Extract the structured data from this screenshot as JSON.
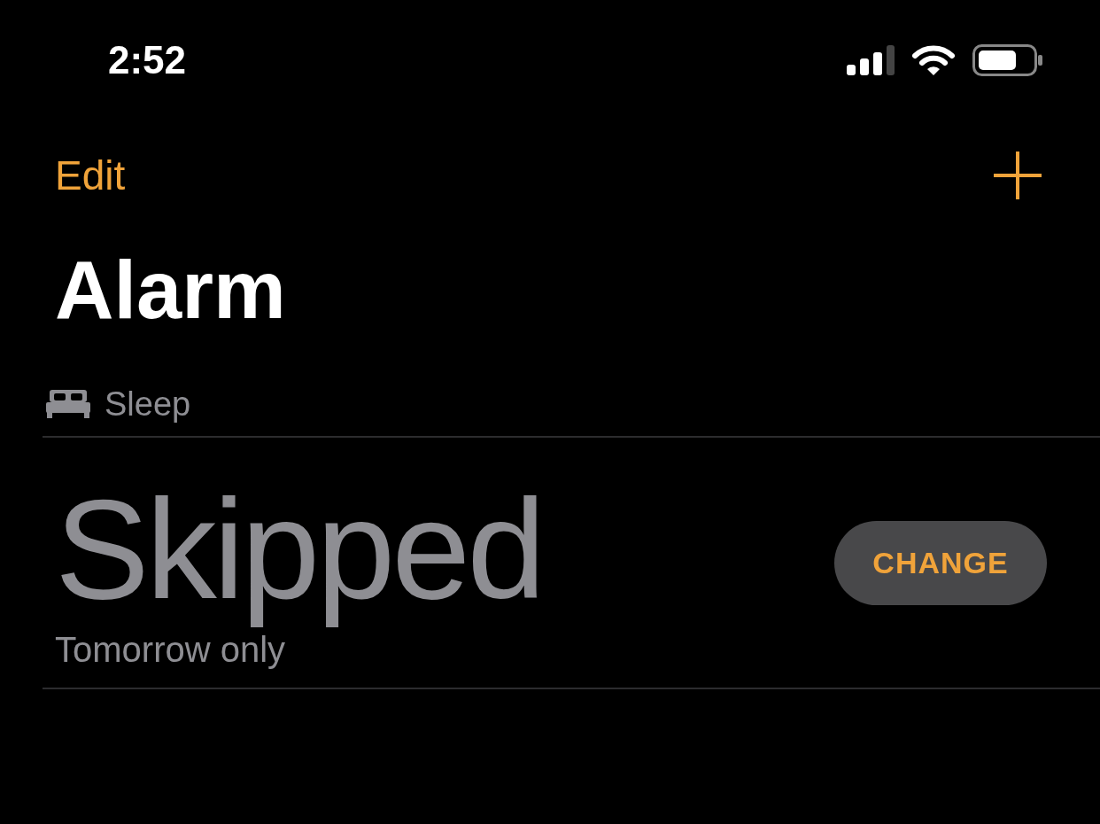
{
  "status_bar": {
    "time": "2:52"
  },
  "nav": {
    "edit": "Edit"
  },
  "title": "Alarm",
  "section": {
    "label": "Sleep"
  },
  "alarm": {
    "time": "Skipped",
    "detail": "Tomorrow only",
    "button": "CHANGE"
  }
}
